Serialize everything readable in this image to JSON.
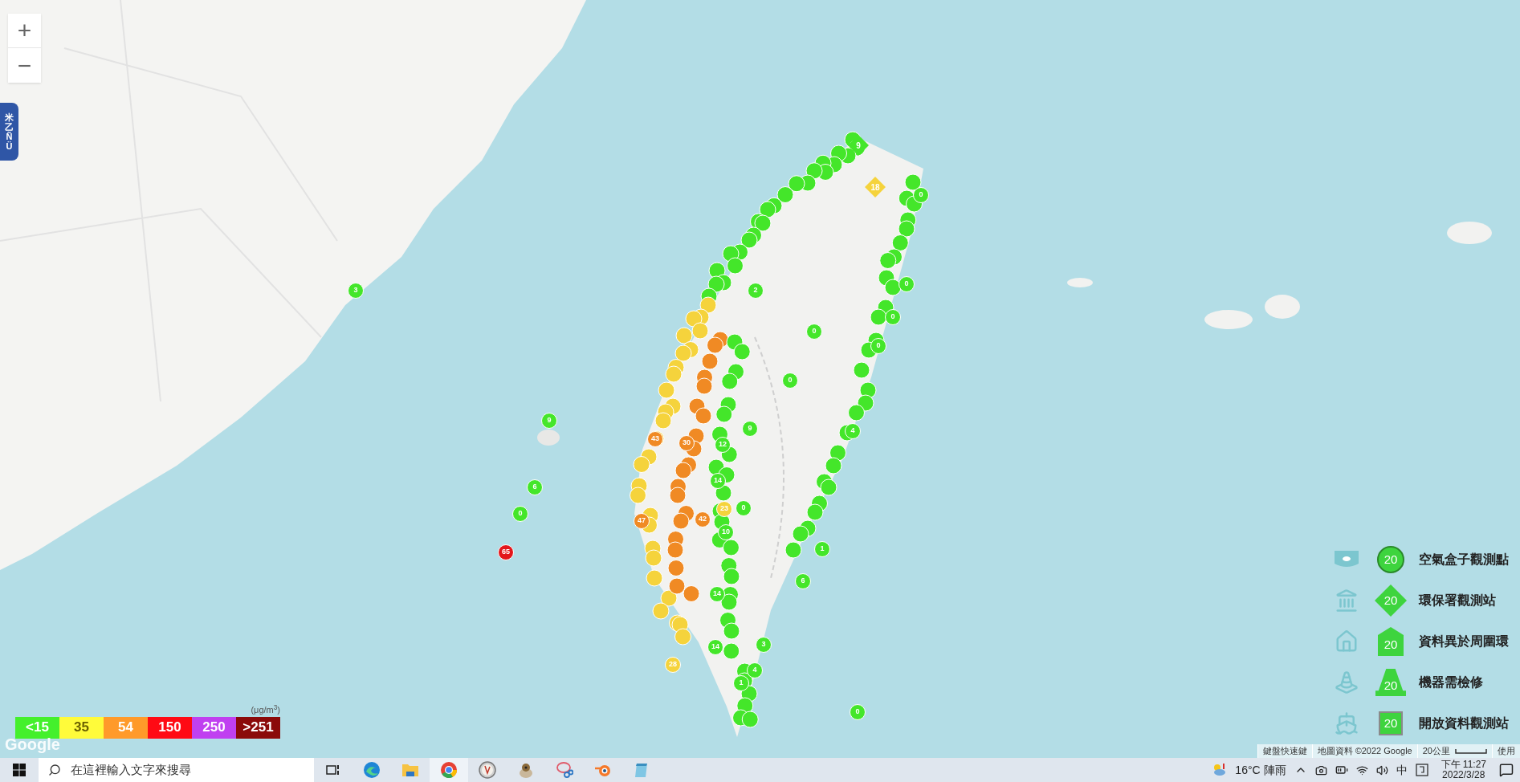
{
  "map_controls": {
    "zoom_in": "+",
    "zoom_out": "−"
  },
  "side_tab": {
    "label": "米乙ÑÜ"
  },
  "markers": [
    {
      "label": "65",
      "kind": "circle",
      "color": "#e3161b"
    },
    {
      "label": "0",
      "kind": "circle",
      "color": "#44e62a"
    },
    {
      "label": "6",
      "kind": "circle",
      "color": "#44e62a"
    },
    {
      "label": "9",
      "kind": "circle",
      "color": "#44e62a"
    },
    {
      "label": "3",
      "kind": "circle",
      "color": "#44e62a"
    },
    {
      "label": "0",
      "kind": "circle",
      "color": "#44e62a"
    },
    {
      "label": "0",
      "kind": "circle",
      "color": "#44e62a"
    },
    {
      "label": "4",
      "kind": "circle",
      "color": "#44e62a"
    },
    {
      "label": "0",
      "kind": "circle",
      "color": "#44e62a"
    },
    {
      "label": "0",
      "kind": "circle",
      "color": "#44e62a"
    },
    {
      "label": "0",
      "kind": "circle",
      "color": "#44e62a"
    },
    {
      "label": "0",
      "kind": "circle",
      "color": "#44e62a"
    },
    {
      "label": "9",
      "kind": "diamond",
      "color": "#44e62a"
    },
    {
      "label": "18",
      "kind": "diamond",
      "color": "#f5d33c"
    },
    {
      "label": "2",
      "kind": "circle",
      "color": "#44e62a"
    },
    {
      "label": "12",
      "kind": "circle",
      "color": "#44e62a"
    },
    {
      "label": "9",
      "kind": "circle",
      "color": "#44e62a"
    },
    {
      "label": "43",
      "kind": "circle",
      "color": "#f08a24"
    },
    {
      "label": "30",
      "kind": "circle",
      "color": "#f08a24"
    },
    {
      "label": "14",
      "kind": "circle",
      "color": "#44e62a"
    },
    {
      "label": "23",
      "kind": "circle",
      "color": "#f5d33c"
    },
    {
      "label": "0",
      "kind": "circle",
      "color": "#44e62a"
    },
    {
      "label": "42",
      "kind": "circle",
      "color": "#f08a24"
    },
    {
      "label": "47",
      "kind": "circle",
      "color": "#f08a24"
    },
    {
      "label": "10",
      "kind": "circle",
      "color": "#44e62a"
    },
    {
      "label": "1",
      "kind": "circle",
      "color": "#44e62a"
    },
    {
      "label": "6",
      "kind": "circle",
      "color": "#44e62a"
    },
    {
      "label": "14",
      "kind": "circle",
      "color": "#44e62a"
    },
    {
      "label": "14",
      "kind": "circle",
      "color": "#44e62a"
    },
    {
      "label": "28",
      "kind": "circle",
      "color": "#f5d33c"
    },
    {
      "label": "3",
      "kind": "circle",
      "color": "#44e62a"
    },
    {
      "label": "4",
      "kind": "circle",
      "color": "#44e62a"
    },
    {
      "label": "1",
      "kind": "circle",
      "color": "#44e62a"
    },
    {
      "label": "0",
      "kind": "circle",
      "color": "#44e62a"
    }
  ],
  "legend": [
    {
      "kind": "circle",
      "value": "20",
      "label": "空氣盒子觀測點"
    },
    {
      "kind": "diamond",
      "value": "20",
      "label": "環保署觀測站"
    },
    {
      "kind": "house",
      "value": "20",
      "label": "資料異於周圍環"
    },
    {
      "kind": "cone",
      "value": "20",
      "label": "機器需檢修"
    },
    {
      "kind": "square",
      "value": "20",
      "label": "開放資料觀測站"
    }
  ],
  "color_scale": {
    "unit": "(μg/m$^{3}$)",
    "levels": [
      {
        "label": "<15",
        "color": "#44f02c"
      },
      {
        "label": "35",
        "color": "#fffb3a"
      },
      {
        "label": "54",
        "color": "#ff9a2a"
      },
      {
        "label": "150",
        "color": "#ff0a14"
      },
      {
        "label": "250",
        "color": "#c040f0"
      },
      {
        "label": ">251",
        "color": "#8b0a0a"
      }
    ]
  },
  "map_logo": "Google",
  "attribution": [
    "鍵盤快速鍵",
    "地圖資料 ©2022 Google",
    "20公里",
    "使用"
  ],
  "taskbar": {
    "search": {
      "placeholder": "在這裡輸入文字來搜尋"
    },
    "apps": [
      {
        "kind": "taskview",
        "selected": false
      },
      {
        "kind": "edge",
        "selected": false
      },
      {
        "kind": "folder",
        "selected": false
      },
      {
        "kind": "chrome",
        "selected": true
      },
      {
        "kind": "compass",
        "selected": false
      },
      {
        "kind": "gimp",
        "selected": false
      },
      {
        "kind": "snip",
        "selected": false
      },
      {
        "kind": "blender",
        "selected": false
      },
      {
        "kind": "notepad",
        "selected": false
      }
    ],
    "weather": "16°C 陣雨",
    "ime": "中",
    "time": "下午 11:27",
    "date": "2022/3/28"
  }
}
